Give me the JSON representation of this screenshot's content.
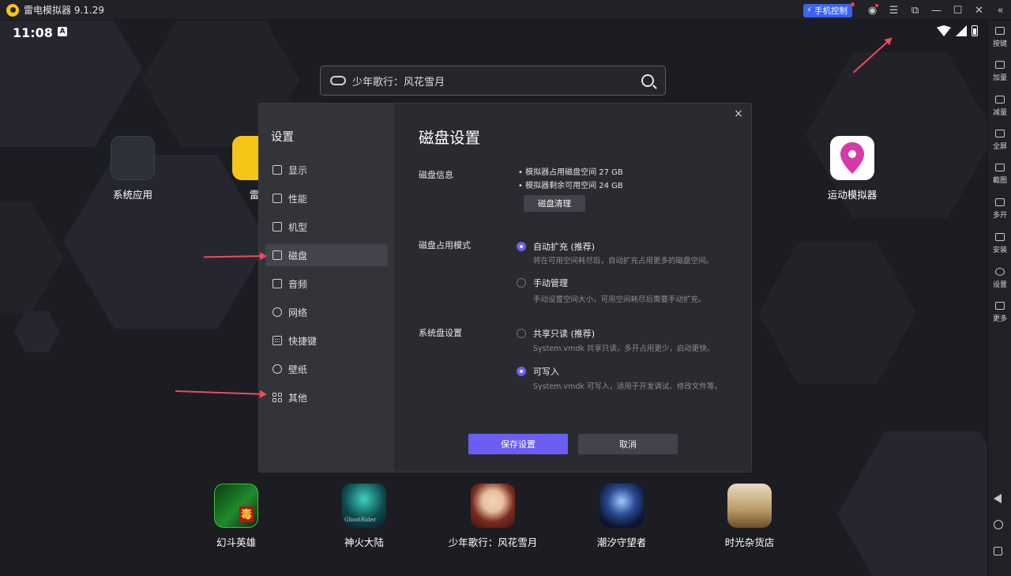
{
  "window": {
    "title": "雷电模拟器 9.1.29",
    "phone_control_label": "手机控制",
    "icons": [
      "account-icon",
      "menu-icon",
      "restore-window-icon",
      "minimize-icon",
      "maximize-icon",
      "close-icon",
      "collapse-sidebar-icon"
    ]
  },
  "statusbar": {
    "time": "11:08",
    "notification_letter": "A"
  },
  "search": {
    "query": "少年歌行：风花雪月"
  },
  "desktop_apps": [
    {
      "label": "系统应用"
    },
    {
      "label": "雷"
    },
    {
      "label": "运动模拟器"
    }
  ],
  "dock_apps": [
    {
      "label": "幻斗英雄",
      "badge": "毒"
    },
    {
      "label": "神火大陆",
      "badge": "GhostRider"
    },
    {
      "label": "少年歌行：风花雪月"
    },
    {
      "label": "潮汐守望者"
    },
    {
      "label": "时光杂货店"
    }
  ],
  "settings": {
    "title": "设置",
    "close_glyph": "×",
    "nav": [
      {
        "label": "显示",
        "icon": "display-icon"
      },
      {
        "label": "性能",
        "icon": "performance-icon"
      },
      {
        "label": "机型",
        "icon": "device-model-icon"
      },
      {
        "label": "磁盘",
        "icon": "disk-icon",
        "active": true
      },
      {
        "label": "音频",
        "icon": "audio-icon"
      },
      {
        "label": "网络",
        "icon": "network-icon"
      },
      {
        "label": "快捷键",
        "icon": "keyboard-icon"
      },
      {
        "label": "壁纸",
        "icon": "wallpaper-icon"
      },
      {
        "label": "其他",
        "icon": "other-icon"
      }
    ],
    "page_title": "磁盘设置",
    "disk_info": {
      "label": "磁盘信息",
      "lines": [
        "• 模拟器占用磁盘空间 27 GB",
        "• 模拟器剩余可用空间 24 GB"
      ],
      "clean_button": "磁盘清理"
    },
    "disk_mode": {
      "label": "磁盘占用模式",
      "options": [
        {
          "label": "自动扩充 (推荐)",
          "desc": "将在可用空间耗尽后，自动扩充占用更多的磁盘空间。",
          "selected": true
        },
        {
          "label": "手动管理",
          "desc": "手动设置空间大小，可用空间耗尽后需要手动扩充。",
          "selected": false
        }
      ]
    },
    "system_disk": {
      "label": "系统盘设置",
      "options": [
        {
          "label": "共享只读 (推荐)",
          "desc": "System.vmdk 共享只读，多开占用更少，启动更快。",
          "selected": false
        },
        {
          "label": "可写入",
          "desc": "System.vmdk 可写入，适用于开发调试、修改文件等。",
          "selected": true
        }
      ]
    },
    "save_button": "保存设置",
    "cancel_button": "取消"
  },
  "right_toolbar": [
    {
      "label": "按键",
      "icon": "keymap-icon"
    },
    {
      "label": "加量",
      "icon": "volume-up-icon"
    },
    {
      "label": "减量",
      "icon": "volume-down-icon"
    },
    {
      "label": "全屏",
      "icon": "fullscreen-icon"
    },
    {
      "label": "截图",
      "icon": "screenshot-icon"
    },
    {
      "label": "多开",
      "icon": "multi-instance-icon"
    },
    {
      "label": "安装",
      "icon": "install-icon"
    },
    {
      "label": "设置",
      "icon": "settings-icon"
    },
    {
      "label": "更多",
      "icon": "more-icon"
    }
  ],
  "colors": {
    "accent": "#6b5ef5",
    "phone_control": "#3a63f0",
    "annotation_arrow": "#f04a5a"
  }
}
